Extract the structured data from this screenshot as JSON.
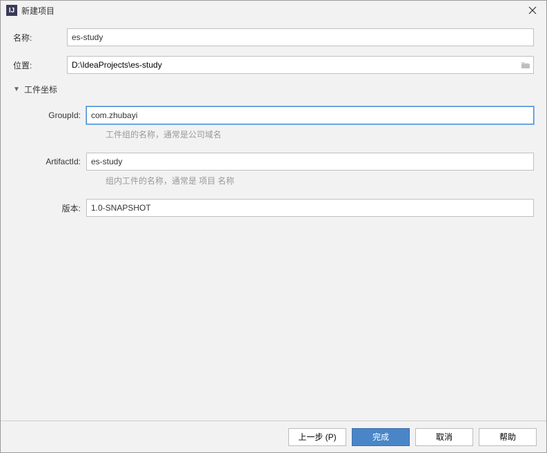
{
  "titlebar": {
    "icon_text": "IJ",
    "title": "新建项目"
  },
  "form": {
    "name_label": "名称:",
    "name_value": "es-study",
    "location_label": "位置:",
    "location_value": "D:\\IdeaProjects\\es-study"
  },
  "section": {
    "title": "工件坐标"
  },
  "artifact": {
    "groupid_label": "GroupId:",
    "groupid_value": "com.zhubayi",
    "groupid_hint": "工件组的名称，通常是公司域名",
    "artifactid_label": "ArtifactId:",
    "artifactid_value": "es-study",
    "artifactid_hint": "组内工件的名称，通常是 项目 名称",
    "version_label": "版本:",
    "version_value": "1.0-SNAPSHOT"
  },
  "buttons": {
    "previous": "上一步 (P)",
    "finish": "完成",
    "cancel": "取消",
    "help": "帮助"
  }
}
